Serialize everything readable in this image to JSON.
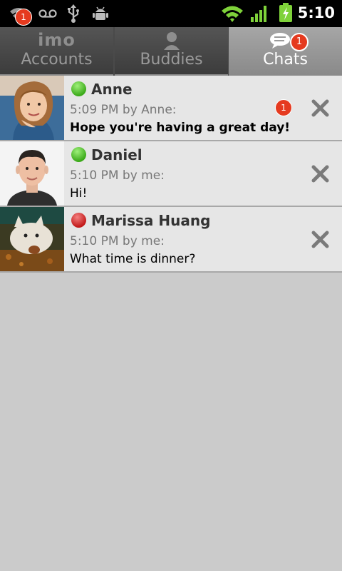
{
  "status_bar": {
    "time": "5:10",
    "notification_count": "1",
    "icons": [
      "notification-icon",
      "voicemail-icon",
      "usb-icon",
      "android-debug-icon",
      "wifi-icon",
      "signal-icon",
      "battery-charging-icon"
    ]
  },
  "tabs": [
    {
      "logo": "imo",
      "label": "Accounts",
      "selected": false
    },
    {
      "label": "Buddies",
      "icon": "buddy-icon",
      "selected": false
    },
    {
      "label": "Chats",
      "icon": "chat-bubble-icon",
      "badge": "1",
      "selected": true
    }
  ],
  "chats": [
    {
      "name": "Anne",
      "status": "online",
      "meta": "5:09 PM by Anne:",
      "message": "Hope you're having a great day!",
      "unread": true,
      "badge": "1"
    },
    {
      "name": "Daniel",
      "status": "online",
      "meta": "5:10 PM by me:",
      "message": "Hi!",
      "unread": false
    },
    {
      "name": "Marissa Huang",
      "status": "busy",
      "meta": "5:10 PM by me:",
      "message": "What time is dinner?",
      "unread": false
    }
  ],
  "colors": {
    "online": "#3caa1a",
    "busy": "#c21a1a",
    "badge": "#e53a1f",
    "tab_selected": "#9a9a9a"
  }
}
